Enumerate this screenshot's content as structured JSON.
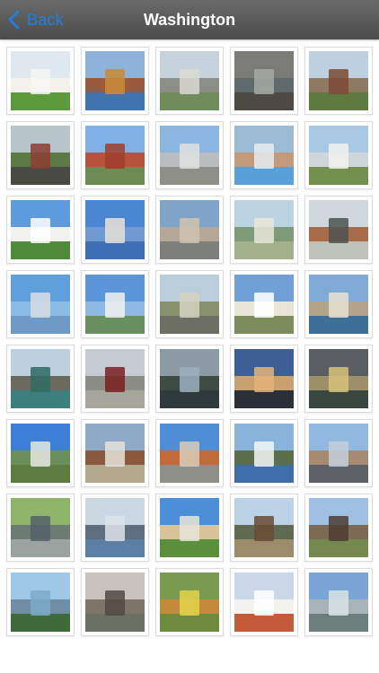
{
  "header": {
    "title": "Washington",
    "back_label": "Back",
    "accent": "#1f7fe0"
  },
  "gallery": {
    "photos": [
      {
        "sky": "#dfe8ee",
        "mid": "#f3f1ea",
        "gnd": "#5d9a3d",
        "subject": "#f7f7f4"
      },
      {
        "sky": "#8fb3d8",
        "mid": "#9a5b3c",
        "gnd": "#3f74b0",
        "subject": "#c98a3a"
      },
      {
        "sky": "#c6d3dc",
        "mid": "#8c8f88",
        "gnd": "#6f8c5a",
        "subject": "#d9d9d2"
      },
      {
        "sky": "#7b7b78",
        "mid": "#5e6a6c",
        "gnd": "#4d4a44",
        "subject": "#a7a9a2"
      },
      {
        "sky": "#bcd0df",
        "mid": "#8e7a63",
        "gnd": "#5f7a3e",
        "subject": "#7c4a35"
      },
      {
        "sky": "#b7c4c9",
        "mid": "#5c7a46",
        "gnd": "#4a4a45",
        "subject": "#8b3f33"
      },
      {
        "sky": "#7fb1e6",
        "mid": "#b5543a",
        "gnd": "#6d8c54",
        "subject": "#9c3f2c"
      },
      {
        "sky": "#8ab6e0",
        "mid": "#b9bdbf",
        "gnd": "#8e8f88",
        "subject": "#e0e3e1"
      },
      {
        "sky": "#9bbbd4",
        "mid": "#c39a7a",
        "gnd": "#5aa0d8",
        "subject": "#e6ecf2"
      },
      {
        "sky": "#a9c8e4",
        "mid": "#cfd6da",
        "gnd": "#74904e",
        "subject": "#f2f2ef"
      },
      {
        "sky": "#5d9bdc",
        "mid": "#f1f2ef",
        "gnd": "#4f8a3a",
        "subject": "#ffffff"
      },
      {
        "sky": "#4a86d2",
        "mid": "#6f9ad2",
        "gnd": "#3e6fb4",
        "subject": "#e7e2d8"
      },
      {
        "sky": "#7fa4c8",
        "mid": "#b5a898",
        "gnd": "#7c7f7c",
        "subject": "#cfc4b2"
      },
      {
        "sky": "#bcd3e2",
        "mid": "#7f9a78",
        "gnd": "#a3b08d",
        "subject": "#eae6d9"
      },
      {
        "sky": "#cfd8dc",
        "mid": "#a86c4a",
        "gnd": "#bfc1bb",
        "subject": "#4d534f"
      },
      {
        "sky": "#5fa0dc",
        "mid": "#8bbbe4",
        "gnd": "#6e9ac7",
        "subject": "#d7dee5"
      },
      {
        "sky": "#5a96d8",
        "mid": "#8cb8e2",
        "gnd": "#6a8f5f",
        "subject": "#f0f1ee"
      },
      {
        "sky": "#b9cddb",
        "mid": "#88916e",
        "gnd": "#6c6f62",
        "subject": "#d5d1c1"
      },
      {
        "sky": "#6fa0d6",
        "mid": "#eae6d7",
        "gnd": "#7d8c5c",
        "subject": "#ffffff"
      },
      {
        "sky": "#7fa9d6",
        "mid": "#b2a38a",
        "gnd": "#3d6f97",
        "subject": "#e8e2d1"
      },
      {
        "sky": "#bcd0e0",
        "mid": "#6c6a5e",
        "gnd": "#3d7f7c",
        "subject": "#2f6b63"
      },
      {
        "sky": "#c3ccd3",
        "mid": "#8c8d87",
        "gnd": "#a6a69d",
        "subject": "#7a1f1f"
      },
      {
        "sky": "#8b9aa3",
        "mid": "#3f4b45",
        "gnd": "#2e3a3b",
        "subject": "#9ab0c0"
      },
      {
        "sky": "#3e5f96",
        "mid": "#c9a070",
        "gnd": "#2b2f38",
        "subject": "#e3b47a"
      },
      {
        "sky": "#5a5e62",
        "mid": "#9c8f6a",
        "gnd": "#3a4740",
        "subject": "#d7c27a"
      },
      {
        "sky": "#3d7fd6",
        "mid": "#6b8f5a",
        "gnd": "#5c7d3f",
        "subject": "#e6e6df"
      },
      {
        "sky": "#8faac6",
        "mid": "#8b5a3e",
        "gnd": "#b4a98e",
        "subject": "#e4e3dc"
      },
      {
        "sky": "#4f8ed7",
        "mid": "#c46b3c",
        "gnd": "#8e8f86",
        "subject": "#d9cdb8"
      },
      {
        "sky": "#8ab3dc",
        "mid": "#5b6f4d",
        "gnd": "#3e6ea8",
        "subject": "#f5f7f8"
      },
      {
        "sky": "#92b8e0",
        "mid": "#a58b72",
        "gnd": "#5d6166",
        "subject": "#c4d0da"
      },
      {
        "sky": "#8fb56a",
        "mid": "#6c7c73",
        "gnd": "#9aa3a0",
        "subject": "#55606a"
      },
      {
        "sky": "#c9d7e3",
        "mid": "#5f6f7f",
        "gnd": "#5b7fa5",
        "subject": "#dde3e7"
      },
      {
        "sky": "#4d8ed8",
        "mid": "#d7c49a",
        "gnd": "#5c8f3c",
        "subject": "#e8e5d8"
      },
      {
        "sky": "#bcd2e6",
        "mid": "#5e6b52",
        "gnd": "#9c8c6a",
        "subject": "#6a4a32"
      },
      {
        "sky": "#9fc0e2",
        "mid": "#7d6a55",
        "gnd": "#75894f",
        "subject": "#4e3c34"
      },
      {
        "sky": "#9ec7e8",
        "mid": "#6f8ea6",
        "gnd": "#3f6b3a",
        "subject": "#7caac9"
      },
      {
        "sky": "#c7c3bb",
        "mid": "#7f7468",
        "gnd": "#6a7062",
        "subject": "#4f4a42"
      },
      {
        "sky": "#7a9b4f",
        "mid": "#c28a3a",
        "gnd": "#6d8a3f",
        "subject": "#e3d44b"
      },
      {
        "sky": "#c9d7e6",
        "mid": "#f2f2ef",
        "gnd": "#c45c3a",
        "subject": "#ffffff"
      },
      {
        "sky": "#7aa5d6",
        "mid": "#a9b4b8",
        "gnd": "#6c7e7c",
        "subject": "#d9e4e6"
      }
    ]
  }
}
